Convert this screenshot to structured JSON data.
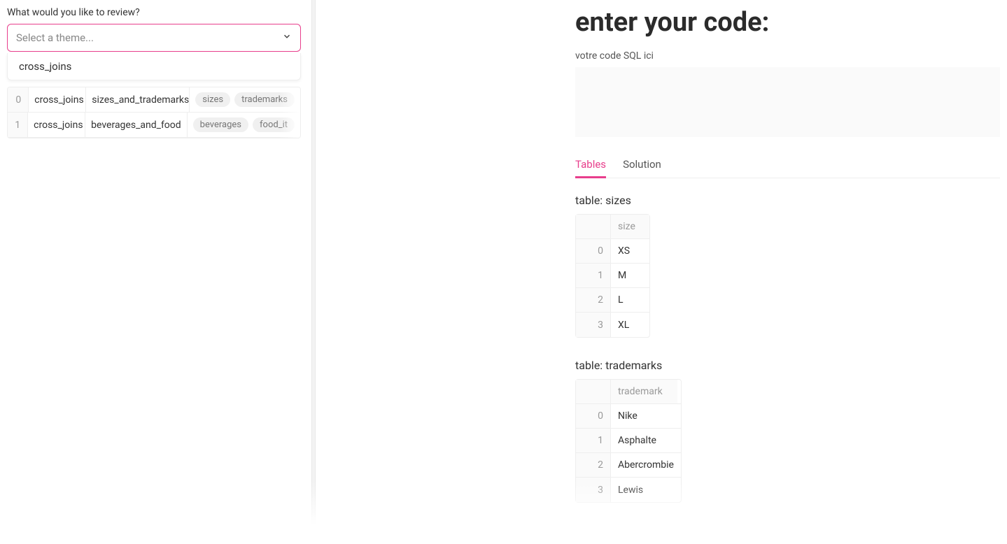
{
  "left": {
    "label": "What would you like to review?",
    "placeholder": "Select a theme...",
    "dropdown_option": "cross_joins",
    "rows": [
      {
        "idx": "0",
        "theme": "cross_joins",
        "name": "sizes_and_trademarks",
        "tags": [
          "sizes",
          "trademarks"
        ]
      },
      {
        "idx": "1",
        "theme": "cross_joins",
        "name": "beverages_and_food",
        "tags": [
          "beverages",
          "food_it"
        ]
      }
    ]
  },
  "right": {
    "title": "enter your code:",
    "subtitle": "votre code SQL ici",
    "tabs": {
      "tables": "Tables",
      "solution": "Solution"
    },
    "table_sizes": {
      "label": "table: sizes",
      "header": "size",
      "rows": [
        {
          "idx": "0",
          "val": "XS"
        },
        {
          "idx": "1",
          "val": "M"
        },
        {
          "idx": "2",
          "val": "L"
        },
        {
          "idx": "3",
          "val": "XL"
        }
      ]
    },
    "table_trademarks": {
      "label": "table: trademarks",
      "header": "trademark",
      "rows": [
        {
          "idx": "0",
          "val": "Nike"
        },
        {
          "idx": "1",
          "val": "Asphalte"
        },
        {
          "idx": "2",
          "val": "Abercrombie"
        },
        {
          "idx": "3",
          "val": "Lewis"
        }
      ]
    }
  }
}
